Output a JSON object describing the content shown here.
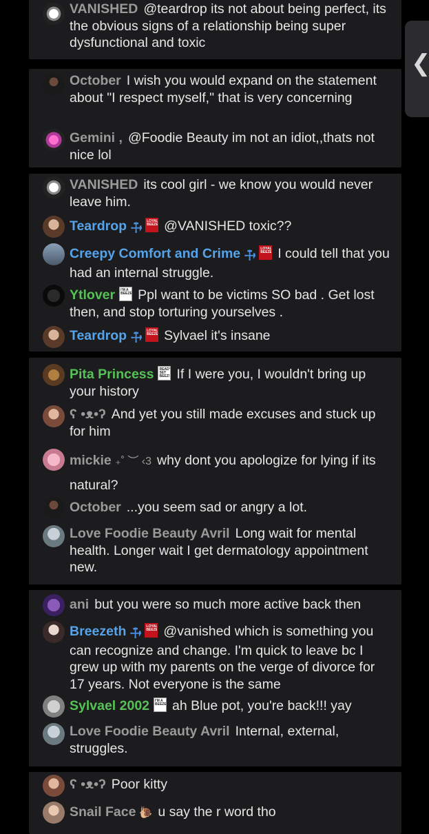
{
  "colors": {
    "background": "#000000",
    "card": "#1c1c1e",
    "name_gray": "#9a9a9a",
    "name_blue": "#56a3ea",
    "name_green": "#56c156",
    "text": "#e6e6e6"
  },
  "side_button": {
    "icon": "chevron-left-icon",
    "glyph": "❮"
  },
  "groups": [
    {
      "comments": [
        {
          "name": "VANISHED",
          "text": "@teardrop its not about being perfect, its the obvious signs of a relationship being super dysfunctional and toxic"
        }
      ]
    },
    {
      "comments": [
        {
          "name": "October",
          "text": "I wish you would expand on the statement about \"I respect myself,\" that is very concerning"
        },
        {
          "name": "Gemini ,",
          "text": "@Foodie Beauty im not an idiot,,thats not nice lol"
        }
      ]
    },
    {
      "comments": [
        {
          "name": "VANISHED",
          "text": "its cool girl - we know you would never leave him."
        },
        {
          "name": "Teardrop",
          "text": "@VANISHED toxic??",
          "badge_text": "LOYALTY BEEZER"
        },
        {
          "name": "Creepy Comfort and Crime",
          "text": "I could tell that you had an internal struggle.",
          "badge_text": "LOYALTY BEEZER"
        },
        {
          "name": "Ytlover",
          "text": "Ppl want to be victims SO bad . Get lost then, and stop torturing yourselves .",
          "badge_text": "I'M A BEEZER"
        },
        {
          "name": "Teardrop",
          "text": "Sylvael it's insane",
          "badge_text": "LOYALTY BEEZER"
        }
      ]
    },
    {
      "comments": [
        {
          "name": "Pita Princess",
          "text": "If I were you, I wouldn't bring up your history",
          "badge_text": "READY SET BEEZ!"
        },
        {
          "name": "ʕ •ᴥ•ʔ",
          "text": "And yet you still made excuses and stuck up for him"
        },
        {
          "name": "mickie",
          "name_suffix": "₊˚ ︶ ‹3",
          "text": "why dont you apologize for lying if its natural?"
        },
        {
          "name": "October",
          "text": "...you seem sad or angry a lot."
        },
        {
          "name": "Love Foodie Beauty Avril",
          "text": "Long wait for mental health. Longer wait I get dermatology appointment new."
        }
      ]
    },
    {
      "comments": [
        {
          "name": "ani",
          "text": "but you were so much more active back then"
        },
        {
          "name": "Breezeth",
          "text": "@vanished which is something you can recognize and change. I'm quick to leave bc I grew up with my parents on the verge of divorce for 17 years. Not everyone is the same",
          "badge_text": "LOYALTY BEEZER"
        },
        {
          "name": "Sylvael 2002",
          "text": "ah Blue pot, you're back!!! yay",
          "badge_text": "I'M A BEEZER"
        },
        {
          "name": "Love Foodie Beauty Avril",
          "text": "Internal, external, struggles."
        }
      ]
    },
    {
      "comments": [
        {
          "name": "ʕ •ᴥ•ʔ",
          "text": "Poor kitty"
        },
        {
          "name": "Snail Face",
          "text": "u say the r word tho"
        }
      ]
    }
  ]
}
